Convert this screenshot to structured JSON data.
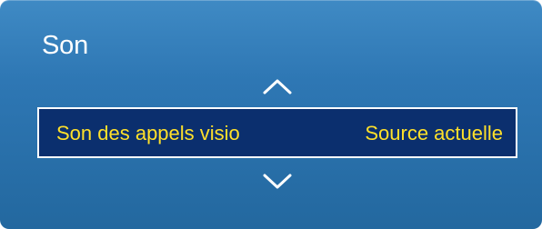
{
  "panel": {
    "title": "Son"
  },
  "menu": {
    "selected_item": {
      "label": "Son des appels visio",
      "value": "Source actuelle"
    },
    "scroll_up_icon": "chevron-up-icon",
    "scroll_down_icon": "chevron-down-icon"
  },
  "colors": {
    "panel_top": "#3f8ac4",
    "panel_bottom": "#23689f",
    "selection_background": "#0b2f6e",
    "selection_text": "#ffe02a",
    "title_text": "#ffffff"
  }
}
